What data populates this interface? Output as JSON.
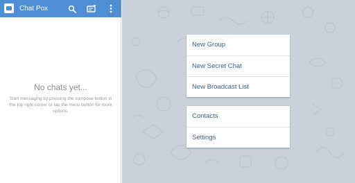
{
  "app": {
    "title": "Chat Pox",
    "accent_color": "#4e8ed4",
    "icons": [
      "app-logo-icon",
      "search-icon",
      "compose-icon",
      "more-vert-icon"
    ]
  },
  "empty_state": {
    "title": "No chats yet...",
    "text": "Start messaging by pressing the compose button in the top right corner or tap the menu button for more options."
  },
  "menu": {
    "group1": [
      {
        "label": "New Group"
      },
      {
        "label": "New Secret Chat"
      },
      {
        "label": "New Broadcast List"
      }
    ],
    "group2": [
      {
        "label": "Contacts"
      },
      {
        "label": "Settings"
      }
    ]
  },
  "background_color": "#c9d2dc"
}
